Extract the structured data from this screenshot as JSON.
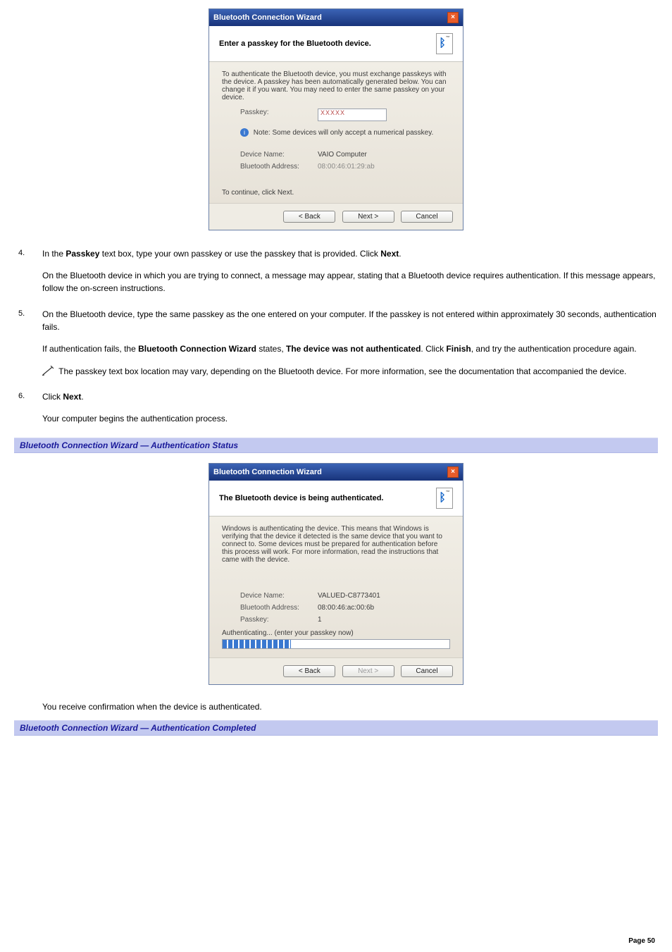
{
  "wizard1": {
    "title": "Bluetooth Connection Wizard",
    "heading": "Enter a passkey for the Bluetooth device.",
    "intro": "To authenticate the Bluetooth device, you must exchange passkeys with the device. A passkey has been automatically generated below. You can change it if you want. You may need to enter the same passkey on your device.",
    "passkey_label": "Passkey:",
    "passkey_value": "XXXXX",
    "note": "Note: Some devices will only accept a numerical passkey.",
    "devname_label": "Device Name:",
    "devname_value": "VAIO Computer",
    "btaddr_label": "Bluetooth Address:",
    "btaddr_value": "08:00:46:01:29:ab",
    "continue": "To continue, click Next.",
    "back": "< Back",
    "next": "Next >",
    "cancel": "Cancel"
  },
  "wizard2": {
    "title": "Bluetooth Connection Wizard",
    "heading": "The Bluetooth device is being authenticated.",
    "intro": "Windows is authenticating the device. This means that Windows is verifying that the device it detected is the same device that you want to connect to. Some devices must be prepared for authentication before this process will work. For more information, read the instructions that came with the device.",
    "devname_label": "Device Name:",
    "devname_value": "VALUED-C8773401",
    "btaddr_label": "Bluetooth Address:",
    "btaddr_value": "08:00:46:ac:00:6b",
    "passkey_label": "Passkey:",
    "passkey_value": "1",
    "status": "Authenticating... (enter your passkey now)",
    "back": "< Back",
    "next": "Next >",
    "cancel": "Cancel"
  },
  "steps": {
    "s4a": "In the ",
    "s4b": "Passkey",
    "s4c": " text box, type your own passkey or use the passkey that is provided. Click ",
    "s4d": "Next",
    "s4e": ".",
    "s4_p2": "On the Bluetooth device in which you are trying to connect, a message may appear, stating that a Bluetooth device requires authentication. If this message appears, follow the on-screen instructions.",
    "s5_p1": "On the Bluetooth device, type the same passkey as the one entered on your computer. If the passkey is not entered within approximately 30 seconds, authentication fails.",
    "s5_p2a": "If authentication fails, the ",
    "s5_p2b": "Bluetooth Connection Wizard",
    "s5_p2c": " states, ",
    "s5_p2d": "The device was not authenticated",
    "s5_p2e": ". Click ",
    "s5_p2f": "Finish",
    "s5_p2g": ", and try the authentication procedure again.",
    "s5_note": " The passkey text box location may vary, depending on the Bluetooth device. For more information, see the documentation that accompanied the device.",
    "s6a": "Click ",
    "s6b": "Next",
    "s6c": ".",
    "s6_p2": "Your computer begins the authentication process.",
    "after2": "You receive confirmation when the device is authenticated."
  },
  "banners": {
    "b1": "Bluetooth Connection Wizard — Authentication Status",
    "b2": "Bluetooth Connection Wizard — Authentication Completed"
  },
  "page": "Page 50"
}
